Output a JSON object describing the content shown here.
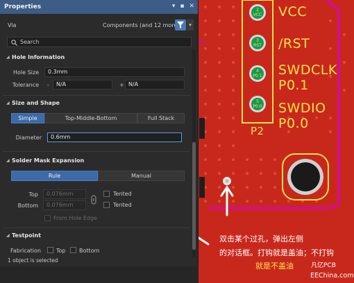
{
  "panel": {
    "title": "Properties",
    "object_type": "Via",
    "components_label": "Components (and 12 more)",
    "search_placeholder": "Search",
    "status": "1 object is selected"
  },
  "hole_information": {
    "title": "Hole Information",
    "hole_size_label": "Hole Size",
    "hole_size_value": "0.3mm",
    "tolerance_label": "Tolerance",
    "tol_minus": "-",
    "tol_plus": "+",
    "tol_minus_value": "N/A",
    "tol_plus_value": "N/A"
  },
  "size_and_shape": {
    "title": "Size and Shape",
    "tabs": [
      "Simple",
      "Top-Middle-Bottom",
      "Full Stack"
    ],
    "active_tab": "Simple",
    "diameter_label": "Diameter",
    "diameter_value": "0.6mm"
  },
  "solder_mask": {
    "title": "Solder Mask Expansion",
    "modes": [
      "Rule",
      "Manual"
    ],
    "active_mode": "Rule",
    "top_label": "Top",
    "bottom_label": "Bottom",
    "top_value": "0.076mm",
    "bottom_value": "0.076mm",
    "tented_top_label": "Tented",
    "tented_bottom_label": "Tented",
    "from_hole_edge_label": "From Hole Edge"
  },
  "testpoint": {
    "title": "Testpoint",
    "fabrication_label": "Fabrication",
    "top_label": "Top",
    "bottom_label": "Bottom"
  },
  "pcb": {
    "silk": [
      "VCC",
      "/RST",
      "SWDCLK",
      "P0.1",
      "SWDIO",
      "P0.0",
      "P2"
    ],
    "pad_labels": [
      [
        "2",
        "VCC"
      ],
      [
        "3",
        "RST"
      ],
      [
        "4",
        "P0.1"
      ],
      [
        "5",
        "P0.0"
      ]
    ]
  },
  "annotation": {
    "line1": "双击某个过孔，弹出左侧",
    "line2_white": "的对话框。",
    "line2_yellow": "打钩就是盖油；不打钩",
    "line3": "就是不盖油",
    "watermark_brand": "凡亿PCB",
    "watermark_site": "EEChina.com"
  },
  "colors": {
    "board": "#c8281c",
    "silkscreen": "#ffe24a",
    "panel_bg": "#2b2b2b",
    "title_bar": "#3d5c86",
    "accent": "#3d6aa8",
    "keepout": "#d400d4"
  }
}
